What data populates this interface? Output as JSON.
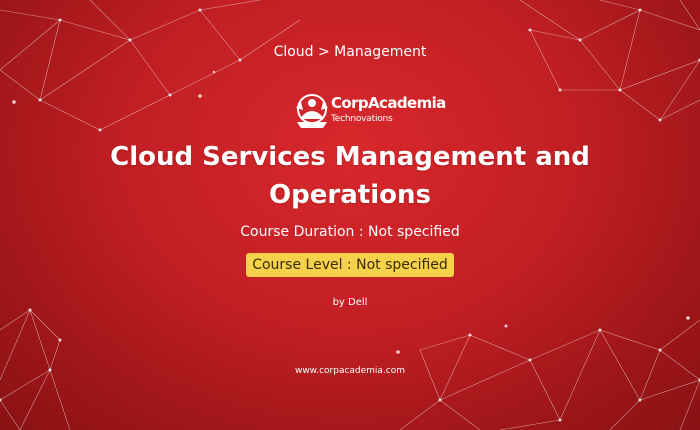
{
  "breadcrumb": "Cloud > Management",
  "logo": {
    "name": "CorpAcademia",
    "tagline": "Technovations"
  },
  "title": "Cloud Services Management and Operations",
  "duration": "Course Duration : Not specified",
  "level": "Course Level : Not specified",
  "author": "by Dell",
  "website": "www.corpacademia.com",
  "colors": {
    "background": "#c11f24",
    "level_badge": "#f6d24a",
    "text": "#ffffff"
  }
}
